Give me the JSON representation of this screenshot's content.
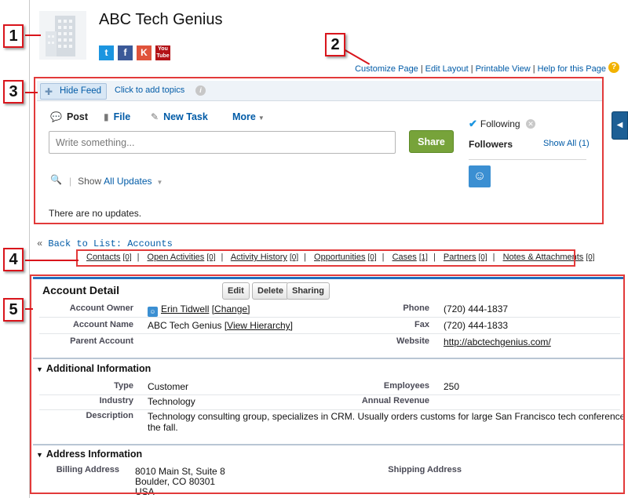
{
  "callouts": [
    "1",
    "2",
    "3",
    "4",
    "5"
  ],
  "account": {
    "name": "ABC Tech Genius",
    "social": {
      "twitter": "t",
      "facebook": "f",
      "klout": "K",
      "youtube": "You Tube"
    }
  },
  "top_links": [
    "Customize Page",
    "Edit Layout",
    "Printable View",
    "Help for this Page"
  ],
  "feed": {
    "hide_feed": "Hide Feed",
    "add_topics": "Click to add topics",
    "tabs": {
      "post": "Post",
      "file": "File",
      "task": "New Task",
      "more": "More"
    },
    "placeholder": "Write something...",
    "share": "Share",
    "show_prefix": "Show",
    "show_filter": "All Updates",
    "empty": "There are no updates.",
    "following": "Following",
    "followers": "Followers",
    "show_all": "Show All (1)"
  },
  "back_link": {
    "prefix": "«",
    "label": "Back to List: Accounts"
  },
  "related_lists": [
    {
      "label": "Contacts",
      "count": "[0]"
    },
    {
      "label": "Open Activities",
      "count": "[0]"
    },
    {
      "label": "Activity History",
      "count": "[0]"
    },
    {
      "label": "Opportunities",
      "count": "[0]"
    },
    {
      "label": "Cases",
      "count": "[1]"
    },
    {
      "label": "Partners",
      "count": "[0]"
    },
    {
      "label": "Notes & Attachments",
      "count": "[0]"
    }
  ],
  "detail": {
    "title": "Account Detail",
    "buttons": [
      "Edit",
      "Delete",
      "Sharing"
    ],
    "owner_label": "Account Owner",
    "owner_name": "Erin Tidwell",
    "owner_change": "[Change]",
    "name_label": "Account Name",
    "name_value": "ABC Tech Genius",
    "name_hierarchy": "[View Hierarchy]",
    "parent_label": "Parent Account",
    "phone_label": "Phone",
    "phone_value": "(720) 444-1837",
    "fax_label": "Fax",
    "fax_value": "(720) 444-1833",
    "website_label": "Website",
    "website_value": "http://abctechgenius.com/"
  },
  "additional": {
    "title": "Additional Information",
    "type_label": "Type",
    "type_value": "Customer",
    "industry_label": "Industry",
    "industry_value": "Technology",
    "description_label": "Description",
    "description_line1": "Technology consulting group, specializes in CRM. Usually orders customs for large San Francisco tech conference in",
    "description_line2": "the fall.",
    "employees_label": "Employees",
    "employees_value": "250",
    "revenue_label": "Annual Revenue"
  },
  "address": {
    "title": "Address Information",
    "billing_label": "Billing Address",
    "billing_line1": "8010 Main St, Suite 8",
    "billing_line2": "Boulder, CO 80301",
    "billing_line3": "USA",
    "shipping_label": "Shipping Address"
  },
  "colors": {
    "accent": "#236fbd",
    "share": "#77a33a",
    "callout": "#d9151c"
  }
}
